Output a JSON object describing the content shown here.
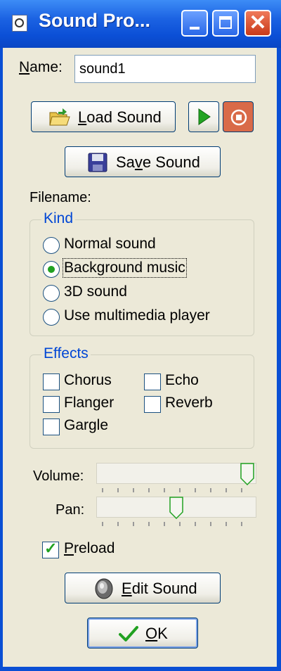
{
  "window": {
    "title": "Sound Pro...",
    "icons": {
      "app": "sound-file-icon",
      "minimize": "minimize-icon",
      "maximize": "maximize-icon",
      "close": "close-icon"
    },
    "close_glyph": "✕"
  },
  "name": {
    "label_ul": "N",
    "label_rest": "ame:",
    "value": "sound1"
  },
  "load_button": {
    "label_ul": "L",
    "label_rest": "oad Sound",
    "icon": "open-folder-icon"
  },
  "play_button": {
    "icon": "play-icon"
  },
  "stop_button": {
    "icon": "stop-icon"
  },
  "save_button": {
    "label_pre": "Sa",
    "label_ul": "v",
    "label_rest": "e Sound",
    "icon": "floppy-disk-icon"
  },
  "filename": {
    "label": "Filename:"
  },
  "kind": {
    "legend": "Kind",
    "options": [
      "Normal sound",
      "Background music",
      "3D sound",
      "Use multimedia player"
    ],
    "selected": "Background music"
  },
  "effects": {
    "legend": "Effects",
    "items": [
      {
        "label": "Chorus",
        "checked": false
      },
      {
        "label": "Echo",
        "checked": false
      },
      {
        "label": "Flanger",
        "checked": false
      },
      {
        "label": "Reverb",
        "checked": false
      },
      {
        "label": "Gargle",
        "checked": false
      }
    ]
  },
  "volume": {
    "label": "Volume:",
    "value_percent": 100
  },
  "pan": {
    "label": "Pan:",
    "value_percent": 50
  },
  "preload": {
    "label_ul": "P",
    "label_rest": "reload",
    "checked": true
  },
  "edit_button": {
    "label_ul": "E",
    "label_rest": "dit Sound",
    "icon": "speaker-icon"
  },
  "ok_button": {
    "label_ul": "O",
    "label_rest": "K",
    "icon": "checkmark-icon"
  },
  "colors": {
    "accent": "#21a121",
    "titlebar": "#0b4fd6",
    "dialog_bg": "#ece9d8",
    "group_legend": "#0046d5"
  }
}
